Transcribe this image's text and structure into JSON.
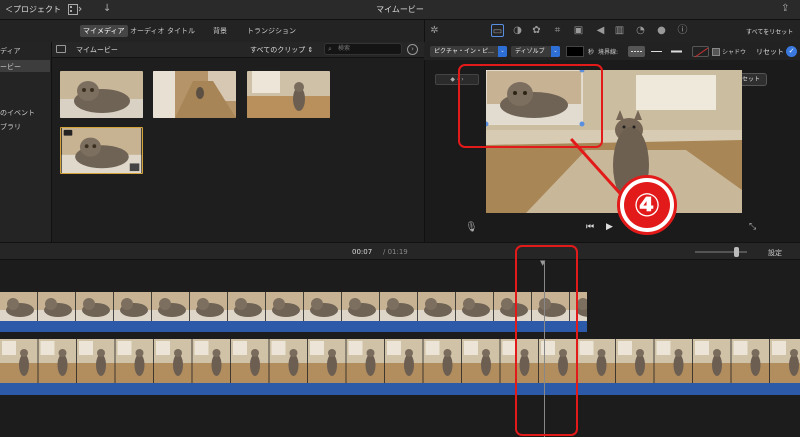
{
  "titlebar": {
    "back_label": "＜プロジェクト",
    "title": "マイムービー"
  },
  "tabs": [
    {
      "label": "マイメディア"
    },
    {
      "label": "オーディオ"
    },
    {
      "label": "タイトル"
    },
    {
      "label": "背景"
    },
    {
      "label": "トランジション"
    }
  ],
  "toolbar": {
    "reset_all_label": "すべてをリセット"
  },
  "sidebar": {
    "items": [
      {
        "label": "ディア"
      },
      {
        "label": "ービー"
      },
      {
        "label": "のイベント"
      },
      {
        "label": "ブラリ"
      }
    ]
  },
  "browser": {
    "library_label": "マイムービー",
    "clips_filter": "すべてのクリップ ⇕",
    "search_placeholder": "検索"
  },
  "viewer": {
    "overlay_mode": "ピクチャ・イン・ピ…",
    "transition_mode": "ディゾルブ",
    "seconds_label": "秒",
    "border_label": "境界線:",
    "shadow_label": "シャドウ",
    "reset_label": "リセット",
    "reset_button": "リセット"
  },
  "timeline": {
    "current_time": "00:07",
    "duration": "/ 01:19",
    "settings_label": "設定"
  },
  "annotation": {
    "step_number": "④"
  },
  "colors": {
    "accent": "#2e6fd6",
    "annotation_red": "#e31a1a",
    "track_blue": "#2c5aa8"
  }
}
